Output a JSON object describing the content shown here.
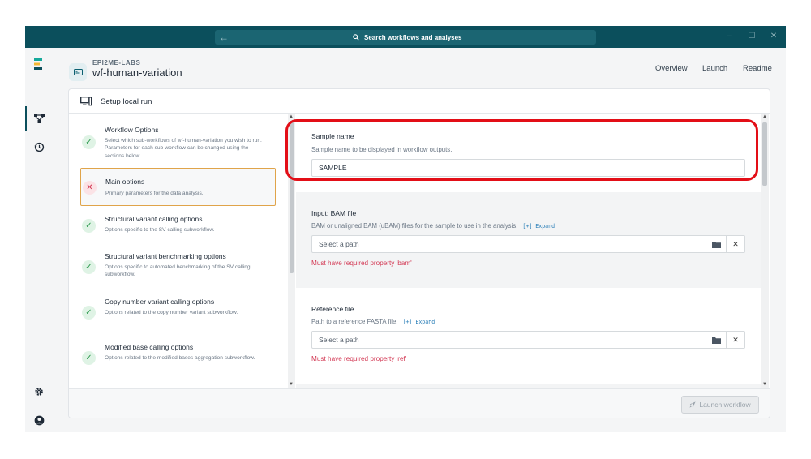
{
  "titlebar": {
    "search_placeholder": "Search workflows and analyses",
    "back_icon": "arrow-left-icon",
    "window_controls": [
      "–",
      "☐",
      "✕"
    ]
  },
  "header": {
    "brand_small": "EPI2ME-LABS",
    "title": "wf-human-variation",
    "links": [
      "Overview",
      "Launch",
      "Readme"
    ]
  },
  "card": {
    "title": "Setup local run"
  },
  "nav": {
    "items": [
      {
        "title": "Workflow Options",
        "desc": "Select which sub-workflows of wf-human-variation you wish to run. Parameters for each sub-workflow can be changed using the sections below.",
        "status": "ok"
      },
      {
        "title": "Main options",
        "desc": "Primary parameters for the data analysis.",
        "status": "error"
      },
      {
        "title": "Structural variant calling options",
        "desc": "Options specific to the SV calling subworkflow.",
        "status": "ok"
      },
      {
        "title": "Structural variant benchmarking options",
        "desc": "Options specific to automated benchmarking of the SV calling subworkflow.",
        "status": "ok"
      },
      {
        "title": "Copy number variant calling options",
        "desc": "Options related to the copy number variant subworkflow.",
        "status": "ok"
      },
      {
        "title": "Modified base calling options",
        "desc": "Options related to the modified bases aggregation subworkflow.",
        "status": "ok"
      }
    ]
  },
  "form": {
    "sample_name": {
      "label": "Sample name",
      "help": "Sample name to be displayed in workflow outputs.",
      "value": "SAMPLE"
    },
    "bam": {
      "label": "Input: BAM file",
      "help": "BAM or unaligned BAM (uBAM) files for the sample to use in the analysis.",
      "expand": "[+] Expand",
      "placeholder": "Select a path",
      "error": "Must have required property 'bam'"
    },
    "ref": {
      "label": "Reference file",
      "help": "Path to a reference FASTA file.",
      "expand": "[+] Expand",
      "placeholder": "Select a path",
      "error": "Must have required property 'ref'"
    }
  },
  "footer": {
    "launch_label": "Launch workflow"
  },
  "colors": {
    "titlebar": "#0b4f5c",
    "error": "#d33a55",
    "success": "#2e9a4f",
    "highlight": "#e30e17",
    "active_border": "#e0a44a"
  }
}
